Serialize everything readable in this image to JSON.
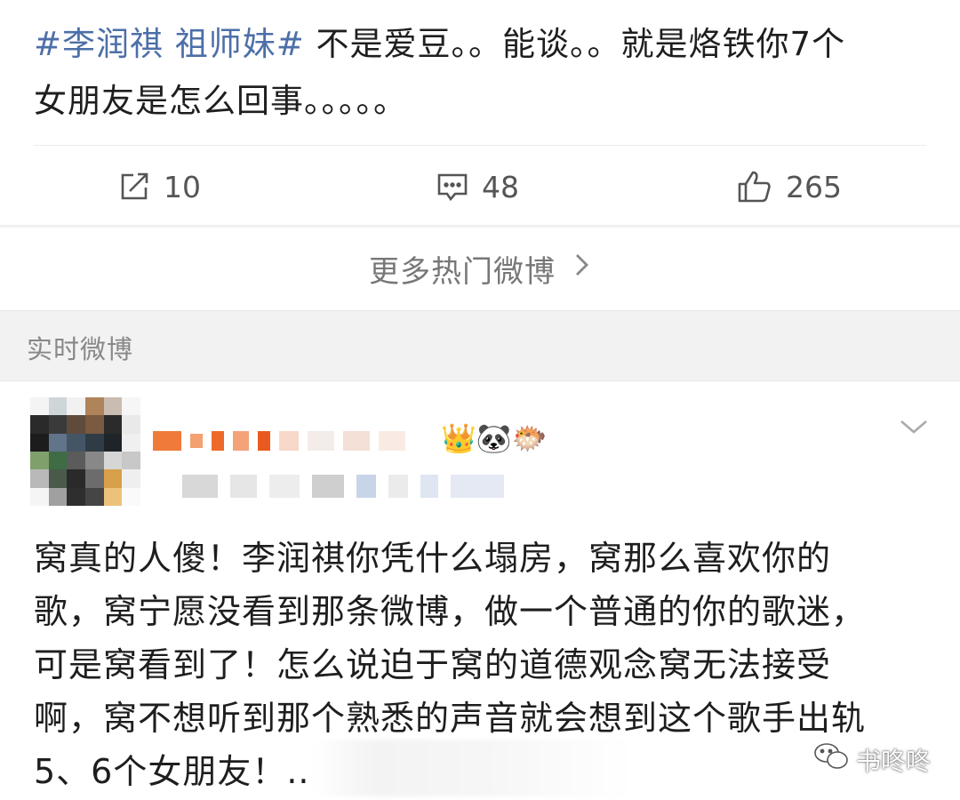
{
  "post": {
    "hashtag": "#李润祺 祖师妹#",
    "text_line1": " 不是爱豆。。能谈。。就是烙铁你7个",
    "text_line2": "女朋友是怎么回事。。。。。"
  },
  "actions": {
    "repost_count": "10",
    "comment_count": "48",
    "like_count": "265"
  },
  "more_link": "更多热门微博",
  "section": {
    "title": "实时微博"
  },
  "feed_item": {
    "badges": "👑🐼🐡",
    "body_lines": [
      "窝真的人傻！李润祺你凭什么塌房，窝那么喜欢你的",
      "歌，窝宁愿没看到那条微博，做一个普通的你的歌迷，",
      "可是窝看到了！怎么说迫于窝的道德观念窝无法接受",
      "啊，窝不想听到那个熟悉的声音就会想到这个歌手出轨",
      "5、6个女朋友！.."
    ]
  },
  "watermark": {
    "text": "书咚咚"
  },
  "colors": {
    "hashtag": "#4d6fa8",
    "muted": "#888888",
    "section_bg": "#f2f2f2"
  }
}
